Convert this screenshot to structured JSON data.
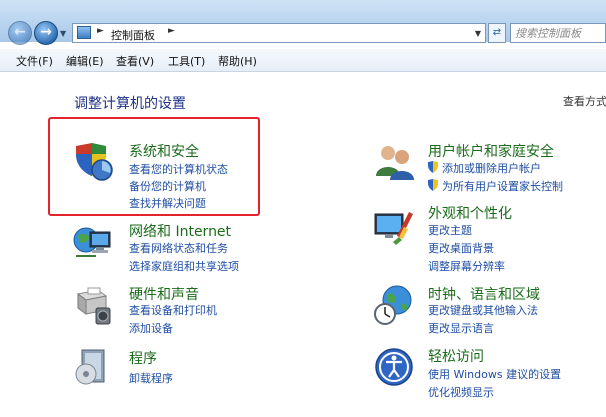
{
  "address": {
    "crumb": "控制面板"
  },
  "search": {
    "placeholder": "搜索控制面板"
  },
  "menu": [
    "文件(F)",
    "编辑(E)",
    "查看(V)",
    "工具(T)",
    "帮助(H)"
  ],
  "heading": "调整计算机的设置",
  "view_by": "查看方式",
  "categories": {
    "system_security": {
      "title": "系统和安全",
      "links": [
        "查看您的计算机状态",
        "备份您的计算机",
        "查找并解决问题"
      ]
    },
    "network": {
      "title": "网络和 Internet",
      "links": [
        "查看网络状态和任务",
        "选择家庭组和共享选项"
      ]
    },
    "hardware": {
      "title": "硬件和声音",
      "links": [
        "查看设备和打印机",
        "添加设备"
      ]
    },
    "programs": {
      "title": "程序",
      "links": [
        "卸载程序"
      ]
    },
    "user_accounts": {
      "title": "用户帐户和家庭安全",
      "links": [
        "添加或删除用户帐户",
        "为所有用户设置家长控制"
      ]
    },
    "appearance": {
      "title": "外观和个性化",
      "links": [
        "更改主题",
        "更改桌面背景",
        "调整屏幕分辨率"
      ]
    },
    "clock": {
      "title": "时钟、语言和区域",
      "links": [
        "更改键盘或其他输入法",
        "更改显示语言"
      ]
    },
    "ease": {
      "title": "轻松访问",
      "links": [
        "使用 Windows 建议的设置",
        "优化视频显示"
      ]
    }
  }
}
